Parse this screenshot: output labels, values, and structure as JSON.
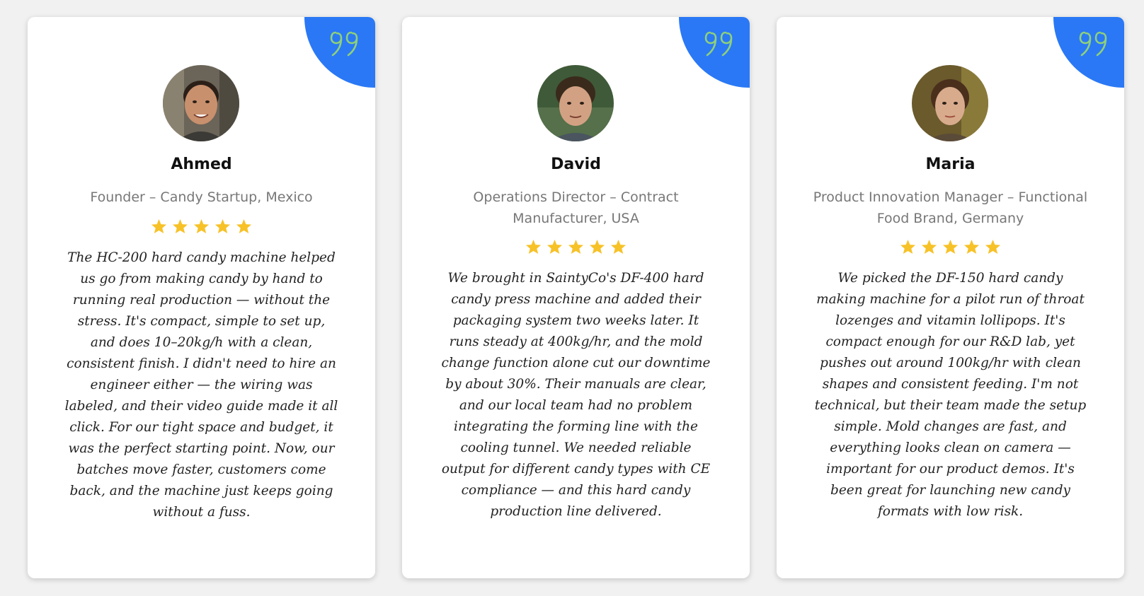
{
  "colors": {
    "page_background": "#f1f1f1",
    "card_background": "#ffffff",
    "accent_blue": "#2a78f5",
    "quote_icon_green": "#8fd07a",
    "star_gold": "#f7c228",
    "name_text": "#111111",
    "role_text": "#777777",
    "review_text": "#222222"
  },
  "testimonials": [
    {
      "name": "Ahmed",
      "role": "Founder – Candy Startup, Mexico",
      "rating": 5,
      "avatar_icon": "avatar-photo-ahmed",
      "review": "The HC-200 hard candy machine helped us go from making candy by hand to running real production — without the stress. It's compact, simple to set up, and does 10–20kg/h with a clean, consistent finish. I didn't need to hire an engineer either — the wiring was labeled, and their video guide made it all click. For our tight space and budget, it was the perfect starting point. Now, our batches move faster, customers come back, and the machine just keeps going without a fuss."
    },
    {
      "name": "David",
      "role": "Operations Director – Contract Manufacturer, USA",
      "rating": 5,
      "avatar_icon": "avatar-photo-david",
      "review": "We brought in SaintyCo's DF-400 hard candy press machine and added their packaging system two weeks later. It runs steady at 400kg/hr, and the mold change function alone cut our downtime by about 30%. Their manuals are clear, and our local team had no problem integrating the forming line with the cooling tunnel. We needed reliable output for different candy types with CE compliance — and this hard candy production line delivered."
    },
    {
      "name": "Maria",
      "role": "Product Innovation Manager – Functional Food Brand, Germany",
      "rating": 5,
      "avatar_icon": "avatar-photo-maria",
      "review": "We picked the DF-150 hard candy making machine for a pilot run of throat lozenges and vitamin lollipops. It's compact enough for our R&D lab, yet pushes out around 100kg/hr with clean shapes and consistent feeding. I'm not technical, but their team made the setup simple. Mold changes are fast, and everything looks clean on camera — important for our product demos. It's been great for launching new candy formats with low risk."
    }
  ]
}
